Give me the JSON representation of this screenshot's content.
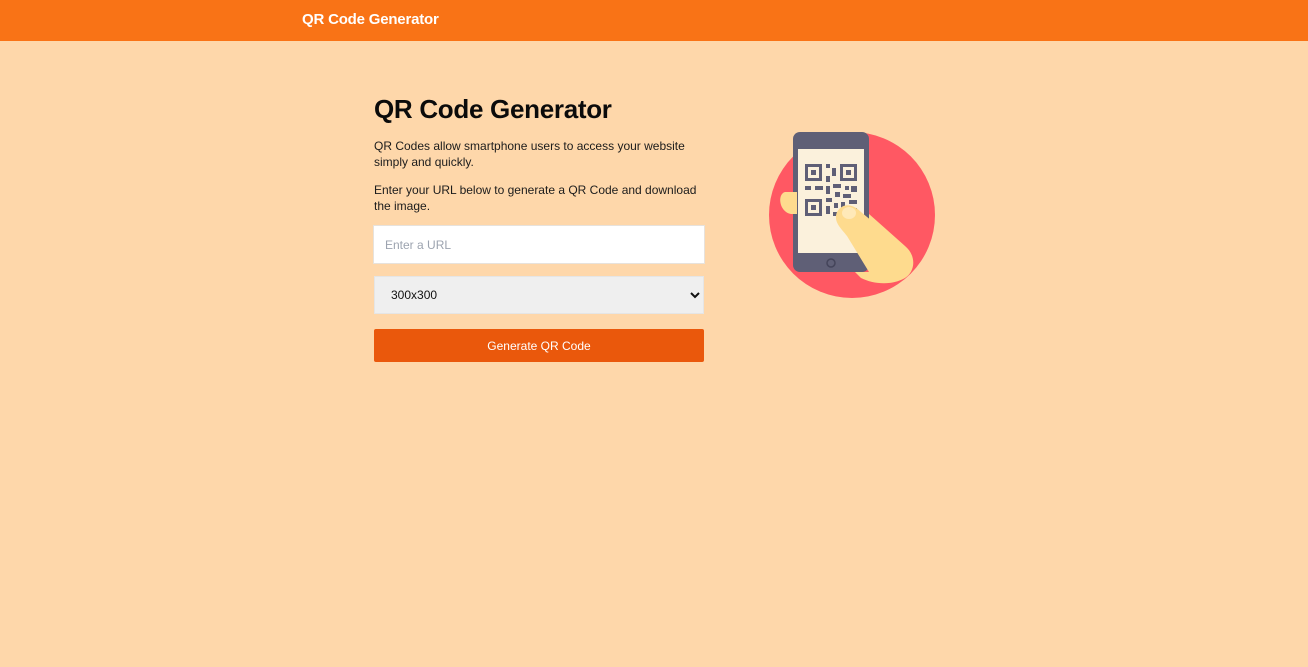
{
  "header": {
    "brand": "QR Code Generator"
  },
  "main": {
    "title": "QR Code Generator",
    "description_1": "QR Codes allow smartphone users to access your website simply and quickly.",
    "description_2": "Enter your URL below to generate a QR Code and download the image.",
    "url_input": {
      "placeholder": "Enter a URL",
      "value": ""
    },
    "size_select": {
      "selected": "300x300"
    },
    "generate_button": "Generate QR Code"
  },
  "illustration": {
    "icon": "phone-qr-scan-icon"
  },
  "colors": {
    "header_bg": "#f97316",
    "page_bg": "#fed7aa",
    "button_bg": "#ea580c",
    "illustration_circle": "#ff5863",
    "phone": "#5f5f76",
    "hand": "#fedb8e"
  }
}
